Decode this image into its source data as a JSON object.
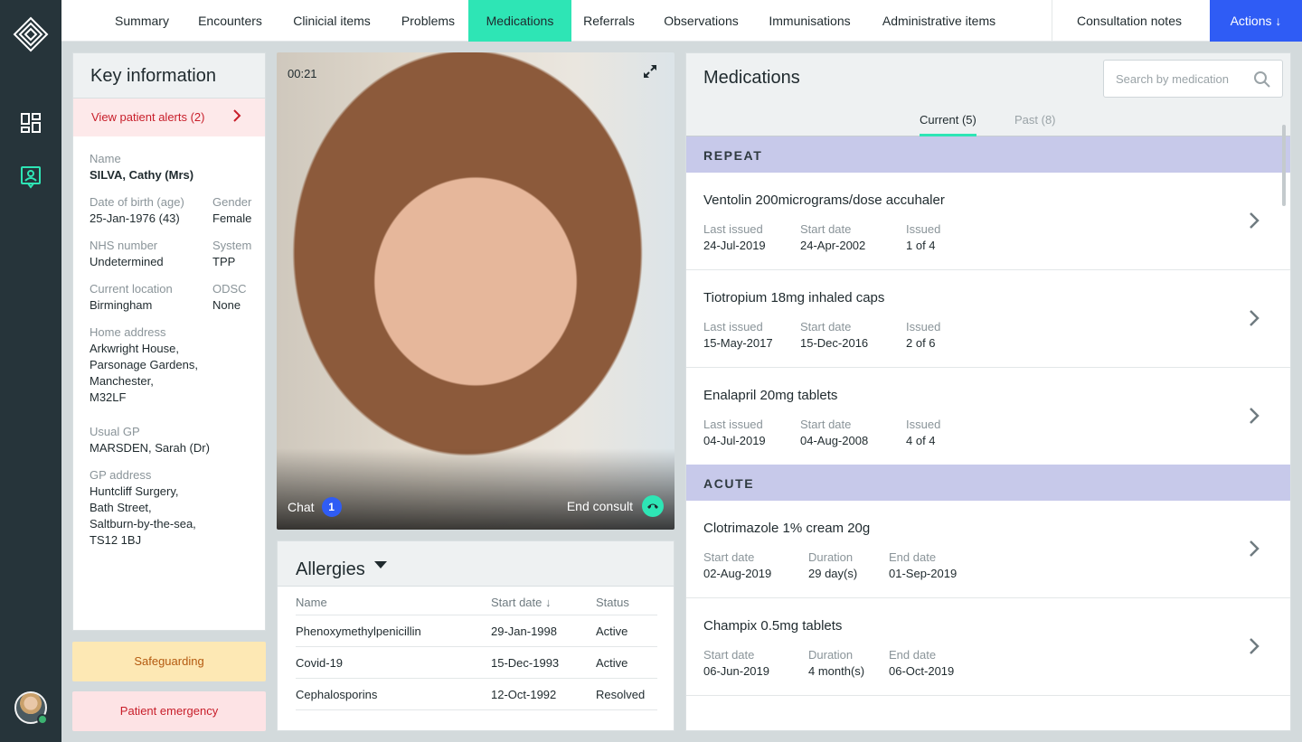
{
  "nav": {
    "tabs": [
      {
        "label": "Summary"
      },
      {
        "label": "Encounters"
      },
      {
        "label": "Clinicial items"
      },
      {
        "label": "Problems"
      },
      {
        "label": "Medications"
      },
      {
        "label": "Referrals"
      },
      {
        "label": "Observations"
      },
      {
        "label": "Immunisations"
      },
      {
        "label": "Administrative items"
      }
    ],
    "active_tab": "Medications",
    "consultation_notes": "Consultation notes",
    "actions": "Actions ↓"
  },
  "colors": {
    "rail": "#26343a",
    "accent": "#2ee5b5",
    "actions": "#2f5cf5",
    "alert": "#c81e2a",
    "section": "#c7c9ea"
  },
  "key_info": {
    "title": "Key information",
    "alerts_link": "View patient alerts (2)",
    "name_label": "Name",
    "name": "SILVA, Cathy (Mrs)",
    "dob_label": "Date of birth (age)",
    "dob": "25-Jan-1976 (43)",
    "gender_label": "Gender",
    "gender": "Female",
    "nhs_label": "NHS number",
    "nhs": "Undetermined",
    "system_label": "System",
    "system": "TPP",
    "location_label": "Current location",
    "location": "Birmingham",
    "odsc_label": "ODSC",
    "odsc": "None",
    "address_label": "Home address",
    "address_lines": [
      "Arkwright House,",
      "Parsonage Gardens,",
      "Manchester,",
      "M32LF"
    ],
    "gp_label": "Usual GP",
    "gp": "MARSDEN, Sarah (Dr)",
    "gp_address_label": "GP address",
    "gp_address_lines": [
      "Huntcliff Surgery,",
      "Bath Street,",
      "Saltburn-by-the-sea,",
      "TS12 1BJ"
    ]
  },
  "safeguarding": "Safeguarding",
  "emergency": "Patient emergency",
  "video": {
    "timer": "00:21",
    "chat": "Chat",
    "chat_count": "1",
    "end": "End consult"
  },
  "allergies": {
    "title": "Allergies",
    "columns": [
      "Name",
      "Start date ↓",
      "Status"
    ],
    "rows": [
      {
        "name": "Phenoxymethylpenicillin",
        "date": "29-Jan-1998",
        "status": "Active"
      },
      {
        "name": "Covid-19",
        "date": "15-Dec-1993",
        "status": "Active"
      },
      {
        "name": "Cephalosporins",
        "date": "12-Oct-1992",
        "status": "Resolved"
      }
    ]
  },
  "medications": {
    "title": "Medications",
    "search_placeholder": "Search by medication",
    "tabs": {
      "current": "Current (5)",
      "past": "Past (8)"
    },
    "repeat_label": "REPEAT",
    "acute_label": "ACUTE",
    "repeat": [
      {
        "name": "Ventolin 200micrograms/dose accuhaler",
        "l1": "Last issued",
        "v1": "24-Jul-2019",
        "l2": "Start date",
        "v2": "24-Apr-2002",
        "l3": "Issued",
        "v3": "1 of 4"
      },
      {
        "name": "Tiotropium 18mg inhaled caps",
        "l1": "Last issued",
        "v1": "15-May-2017",
        "l2": "Start date",
        "v2": "15-Dec-2016",
        "l3": "Issued",
        "v3": "2 of 6"
      },
      {
        "name": "Enalapril 20mg tablets",
        "l1": "Last issued",
        "v1": "04-Jul-2019",
        "l2": "Start date",
        "v2": "04-Aug-2008",
        "l3": "Issued",
        "v3": "4 of 4"
      }
    ],
    "acute": [
      {
        "name": "Clotrimazole 1% cream 20g",
        "l1": "Start date",
        "v1": "02-Aug-2019",
        "l2": "Duration",
        "v2": "29 day(s)",
        "l3": "End date",
        "v3": "01-Sep-2019"
      },
      {
        "name": "Champix 0.5mg tablets",
        "l1": "Start date",
        "v1": "06-Jun-2019",
        "l2": "Duration",
        "v2": "4 month(s)",
        "l3": "End date",
        "v3": "06-Oct-2019"
      }
    ]
  }
}
